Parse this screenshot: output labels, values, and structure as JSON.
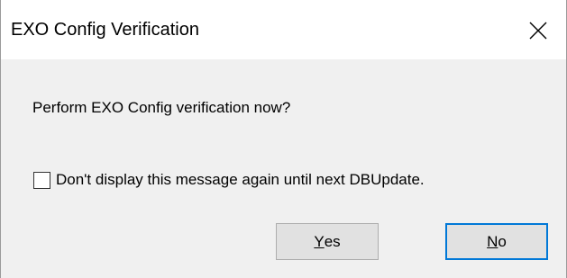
{
  "window": {
    "title": "EXO Config Verification",
    "close_icon": "close-x-icon"
  },
  "dialog": {
    "message": "Perform EXO Config verification now?",
    "checkbox": {
      "label": "Don't display this message again until next DBUpdate.",
      "checked": false
    },
    "buttons": {
      "yes": {
        "mnemonic": "Y",
        "rest": "es"
      },
      "no": {
        "mnemonic": "N",
        "rest": "o"
      }
    }
  },
  "colors": {
    "title_bg": "#ffffff",
    "body_bg": "#f0f0f0",
    "button_bg": "#e1e1e1",
    "focus_border": "#0078d7"
  }
}
